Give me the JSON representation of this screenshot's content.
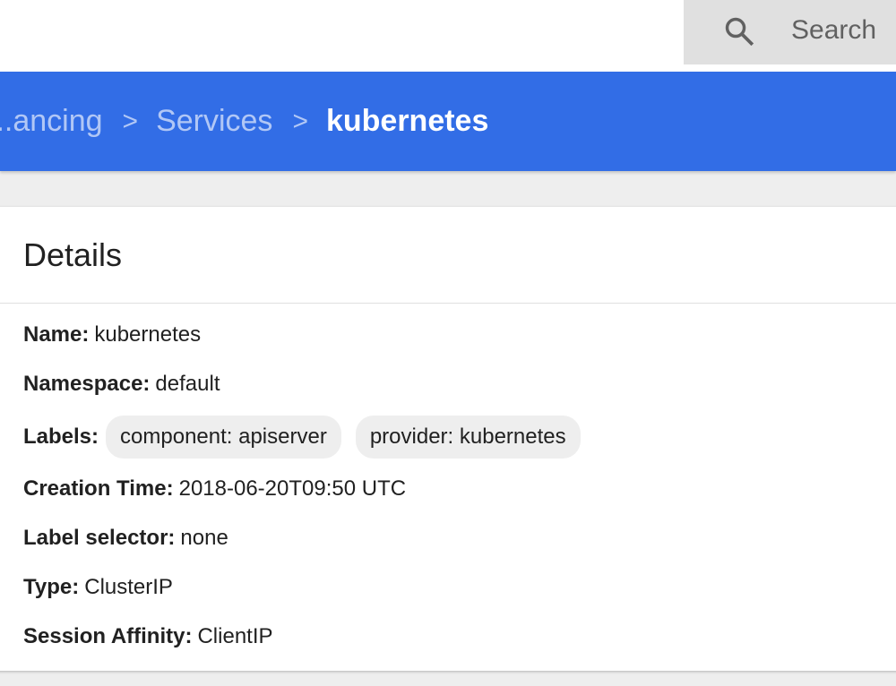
{
  "search": {
    "placeholder": "Search"
  },
  "breadcrumb": {
    "items": [
      "...ancing",
      "Services"
    ],
    "current": "kubernetes",
    "separator": ">"
  },
  "details": {
    "title": "Details",
    "name_label": "Name:",
    "name_value": "kubernetes",
    "namespace_label": "Namespace:",
    "namespace_value": "default",
    "labels_label": "Labels:",
    "labels": [
      "component: apiserver",
      "provider: kubernetes"
    ],
    "creation_label": "Creation Time:",
    "creation_value": "2018-06-20T09:50 UTC",
    "selector_label": "Label selector:",
    "selector_value": "none",
    "type_label": "Type:",
    "type_value": "ClusterIP",
    "affinity_label": "Session Affinity:",
    "affinity_value": "ClientIP"
  },
  "colors": {
    "brand_blue": "#326de6",
    "background": "#eeeeee",
    "chip_background": "#eeeeee"
  },
  "icons": {
    "search": "search-icon"
  }
}
